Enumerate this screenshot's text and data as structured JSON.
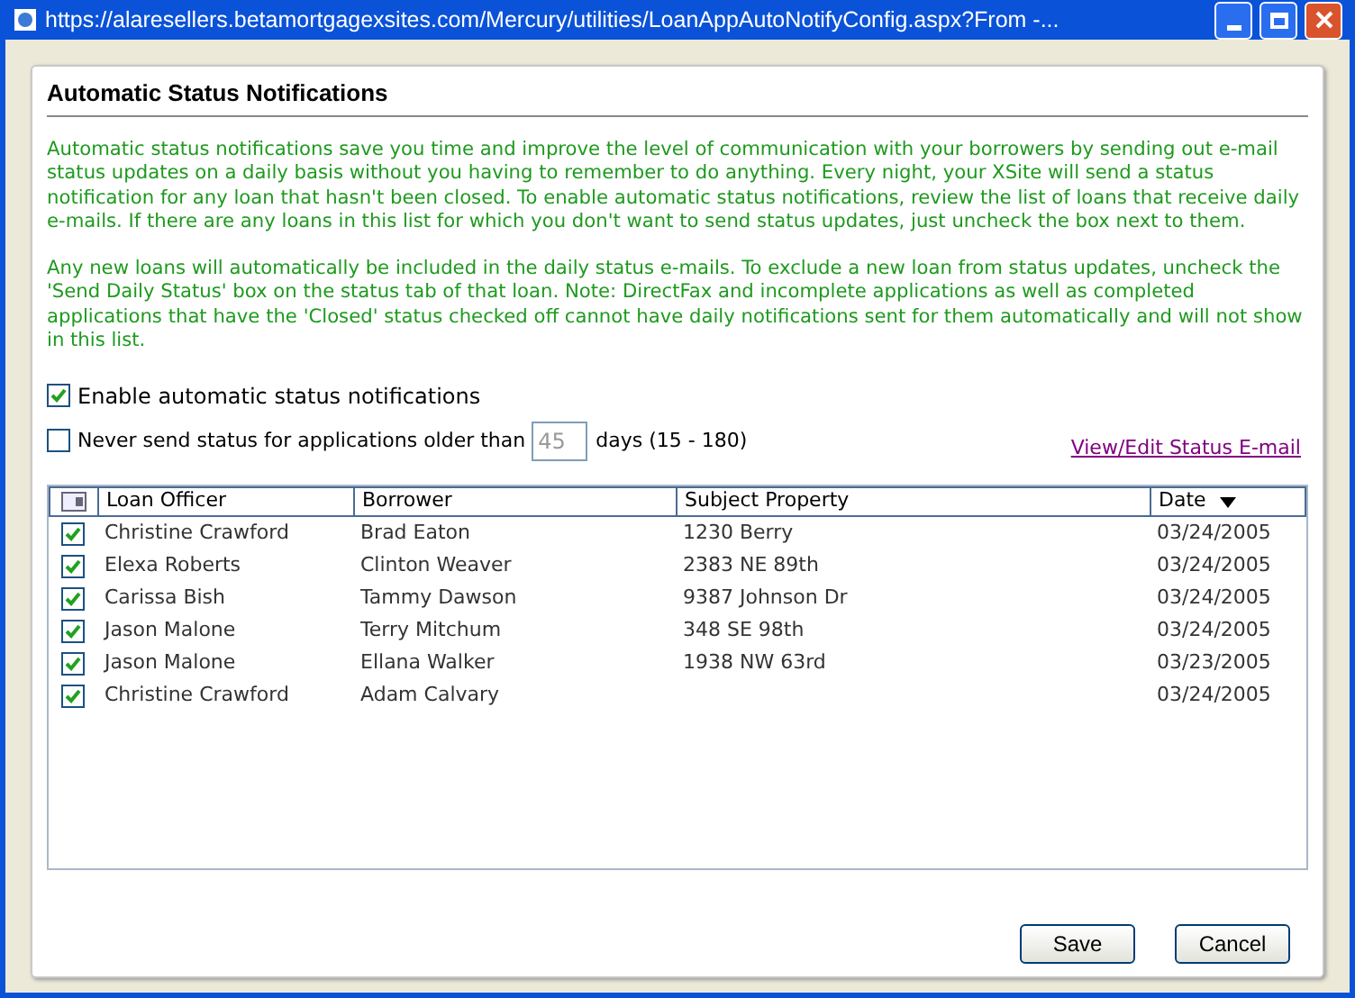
{
  "window": {
    "title": "https://alaresellers.betamortgagexsites.com/Mercury/utilities/LoanAppAutoNotifyConfig.aspx?From -..."
  },
  "heading": "Automatic Status Notifications",
  "paragraphs": [
    "Automatic status notifications save you time and improve the level of communication with your borrowers by sending out e-mail status updates on a daily basis without you having to remember to do anything. Every night, your XSite will send a status notification for any loan that hasn't been closed. To enable automatic status notifications, review the list of loans that receive daily e-mails. If there are any loans in this list for which you don't want to send status updates, just uncheck the box next to them.",
    "Any new loans will automatically be included in the daily status e-mails. To exclude a new loan from status updates, uncheck the 'Send Daily Status' box on the status tab of that loan. Note: DirectFax and incomplete applications as well as completed applications that have the 'Closed' status checked off cannot have daily notifications sent for them automatically and will not show in this list."
  ],
  "enable_option": {
    "label": "Enable automatic status notifications",
    "checked": true
  },
  "age_option": {
    "label": "Never send status for applications older than",
    "checked": false,
    "value": "45",
    "suffix": "days (15 - 180)"
  },
  "edit_link": "View/Edit Status E-mail",
  "table": {
    "columns": [
      "Loan Officer",
      "Borrower",
      "Subject Property",
      "Date"
    ],
    "rows": [
      {
        "checked": true,
        "cells": [
          "Christine Crawford",
          "Brad Eaton",
          "1230 Berry",
          "03/24/2005"
        ]
      },
      {
        "checked": true,
        "cells": [
          "Elexa Roberts",
          "Clinton Weaver",
          "2383 NE 89th",
          "03/24/2005"
        ]
      },
      {
        "checked": true,
        "cells": [
          "Carissa Bish",
          "Tammy Dawson",
          "9387 Johnson Dr",
          "03/24/2005"
        ]
      },
      {
        "checked": true,
        "cells": [
          "Jason Malone",
          "Terry Mitchum",
          "348 SE 98th",
          "03/24/2005"
        ]
      },
      {
        "checked": true,
        "cells": [
          "Jason Malone",
          "Ellana Walker",
          "1938 NW 63rd",
          "03/23/2005"
        ]
      },
      {
        "checked": true,
        "cells": [
          "Christine Crawford",
          "Adam Calvary",
          "",
          "03/24/2005"
        ]
      }
    ]
  },
  "buttons": [
    "Save",
    "Cancel"
  ]
}
